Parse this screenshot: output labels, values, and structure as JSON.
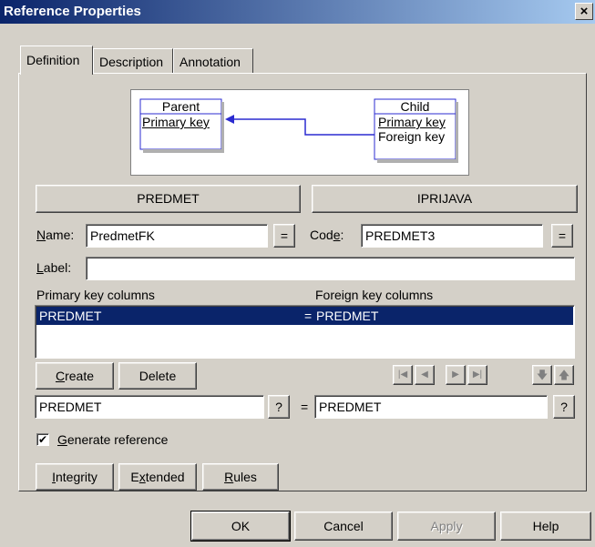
{
  "window": {
    "title": "Reference Properties",
    "close_glyph": "×"
  },
  "tabs": [
    {
      "label": "Definition"
    },
    {
      "label": "Description"
    },
    {
      "label": "Annotation"
    }
  ],
  "diagram": {
    "parent_title": "Parent",
    "parent_key": "Primary key",
    "child_title": "Child",
    "child_key1": "Primary key",
    "child_key2": "Foreign key"
  },
  "tables": {
    "parent": "PREDMET",
    "child": "IPRIJAVA"
  },
  "name": {
    "label_pre": "",
    "label_u": "N",
    "label_post": "ame:",
    "value": "PredmetFK",
    "btn": "="
  },
  "code": {
    "label_pre": "Cod",
    "label_u": "e",
    "label_post": ":",
    "value": "PREDMET3",
    "btn": "="
  },
  "label": {
    "label_u": "L",
    "label_post": "abel:",
    "value": ""
  },
  "columns": {
    "pk_header": "Primary key columns",
    "fk_header": "Foreign key columns",
    "rows": [
      {
        "pk": "PREDMET",
        "eq": "=",
        "fk": "PREDMET"
      }
    ]
  },
  "actions": {
    "create_u": "C",
    "create_post": "reate",
    "delete": "Delete"
  },
  "nav": {
    "first": "|◀",
    "prev": "◀",
    "next": "▶",
    "last": "▶|",
    "down": "🡇",
    "up": "🡅"
  },
  "edit_row": {
    "pk_value": "PREDMET",
    "pk_btn": "?",
    "eq": "=",
    "fk_value": "PREDMET",
    "fk_btn": "?"
  },
  "generate": {
    "checked_mark": "✔",
    "label_u": "G",
    "label_post": "enerate reference"
  },
  "subbuttons": {
    "integrity_u": "I",
    "integrity_post": "ntegrity",
    "extended_pre": "E",
    "extended_u": "x",
    "extended_post": "tended",
    "rules_u": "R",
    "rules_post": "ules"
  },
  "footer": {
    "ok": "OK",
    "cancel": "Cancel",
    "apply": "Apply",
    "help": "Help"
  }
}
